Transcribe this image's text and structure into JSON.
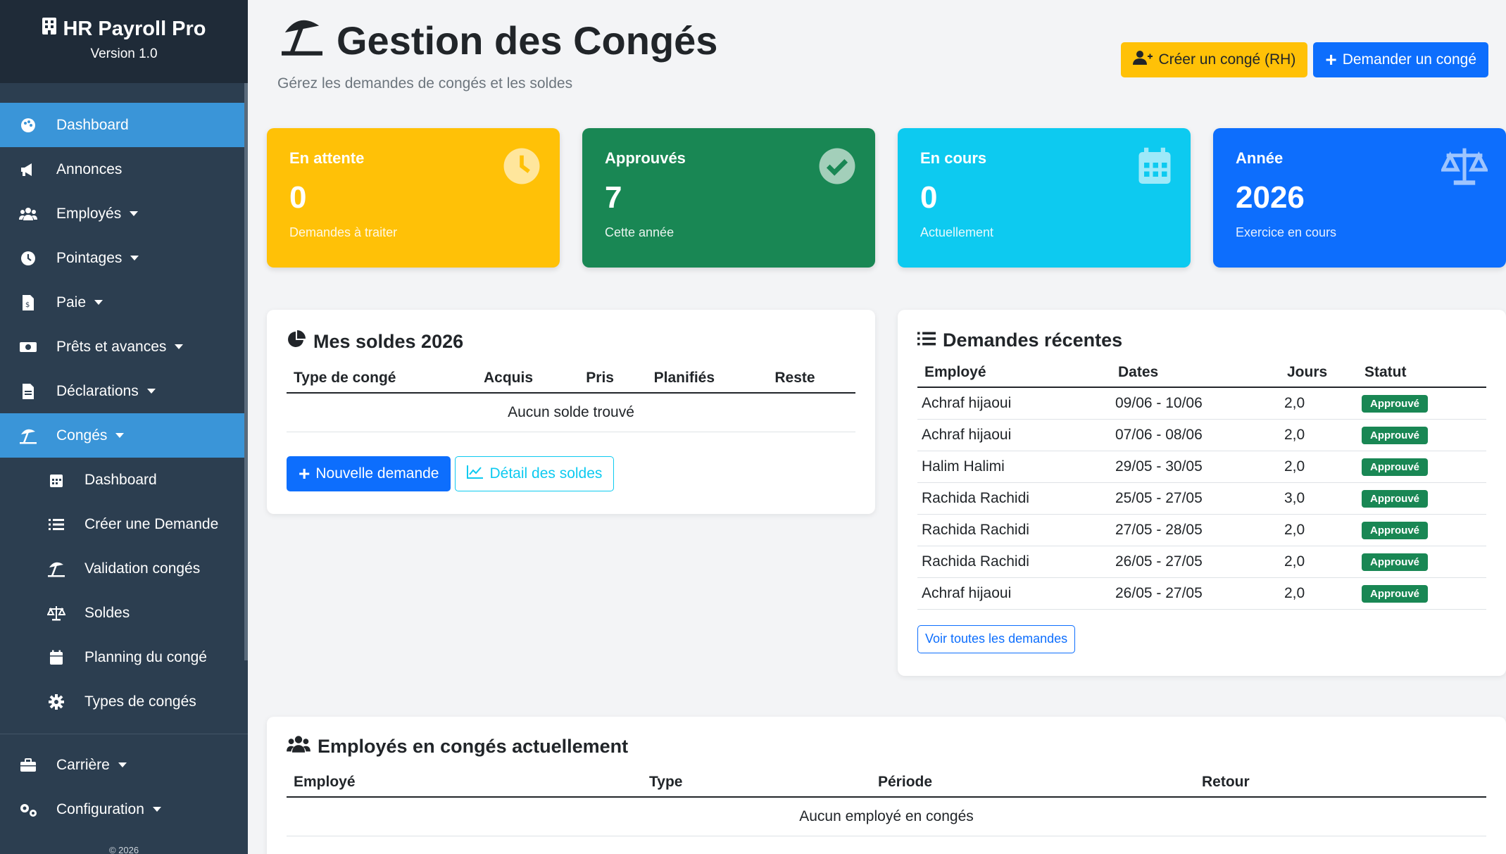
{
  "app": {
    "title": "HR Payroll Pro",
    "version": "Version 1.0",
    "copyright": "© 2026"
  },
  "sidebar": {
    "items": [
      {
        "label": "Dashboard",
        "icon": "palette-icon"
      },
      {
        "label": "Annonces",
        "icon": "megaphone-icon"
      },
      {
        "label": "Employés",
        "icon": "users-icon"
      },
      {
        "label": "Pointages",
        "icon": "clock-icon"
      },
      {
        "label": "Paie",
        "icon": "invoice-icon"
      },
      {
        "label": "Prêts et avances",
        "icon": "money-icon"
      },
      {
        "label": "Déclarations",
        "icon": "document-icon"
      },
      {
        "label": "Congés",
        "icon": "umbrella-beach-icon"
      }
    ],
    "sub_items": [
      {
        "label": "Dashboard",
        "icon": "calendar-icon"
      },
      {
        "label": "Créer une Demande",
        "icon": "list-icon"
      },
      {
        "label": "Validation congés",
        "icon": "umbrella-beach-icon"
      },
      {
        "label": "Soldes",
        "icon": "scale-icon"
      },
      {
        "label": "Planning du congé",
        "icon": "calendar-icon"
      },
      {
        "label": "Types de congés",
        "icon": "gear-icon"
      }
    ],
    "bottom_items": [
      {
        "label": "Carrière",
        "icon": "briefcase-icon"
      },
      {
        "label": "Configuration",
        "icon": "gears-icon"
      }
    ]
  },
  "header": {
    "title": "Gestion des Congés",
    "subtitle": "Gérez les demandes de congés et les soldes",
    "btn_create_rh": "Créer un congé (RH)",
    "btn_request": "Demander un congé"
  },
  "stats": [
    {
      "label": "En attente",
      "value": "0",
      "desc": "Demandes à traiter",
      "color": "#ffc107",
      "icon": "clock-icon"
    },
    {
      "label": "Approuvés",
      "value": "7",
      "desc": "Cette année",
      "color": "#198754",
      "icon": "check-circle-icon"
    },
    {
      "label": "En cours",
      "value": "0",
      "desc": "Actuellement",
      "color": "#0dcaf0",
      "icon": "calendar-icon"
    },
    {
      "label": "Année",
      "value": "2026",
      "desc": "Exercice en cours",
      "color": "#0d6efd",
      "icon": "scale-icon"
    }
  ],
  "soldes": {
    "title": "Mes soldes 2026",
    "headers": [
      "Type de congé",
      "Acquis",
      "Pris",
      "Planifiés",
      "Reste"
    ],
    "empty": "Aucun solde trouvé",
    "btn_new": "Nouvelle demande",
    "btn_detail": "Détail des soldes"
  },
  "recent": {
    "title": "Demandes récentes",
    "headers": [
      "Employé",
      "Dates",
      "Jours",
      "Statut"
    ],
    "rows": [
      {
        "employee": "Achraf hijaoui",
        "dates": "09/06 - 10/06",
        "days": "2,0",
        "status": "Approuvé"
      },
      {
        "employee": "Achraf hijaoui",
        "dates": "07/06 - 08/06",
        "days": "2,0",
        "status": "Approuvé"
      },
      {
        "employee": "Halim Halimi",
        "dates": "29/05 - 30/05",
        "days": "2,0",
        "status": "Approuvé"
      },
      {
        "employee": "Rachida Rachidi",
        "dates": "25/05 - 27/05",
        "days": "3,0",
        "status": "Approuvé"
      },
      {
        "employee": "Rachida Rachidi",
        "dates": "27/05 - 28/05",
        "days": "2,0",
        "status": "Approuvé"
      },
      {
        "employee": "Rachida Rachidi",
        "dates": "26/05 - 27/05",
        "days": "2,0",
        "status": "Approuvé"
      },
      {
        "employee": "Achraf hijaoui",
        "dates": "26/05 - 27/05",
        "days": "2,0",
        "status": "Approuvé"
      }
    ],
    "btn_all": "Voir toutes les demandes"
  },
  "on_leave": {
    "title": "Employés en congés actuellement",
    "headers": [
      "Employé",
      "Type",
      "Période",
      "Retour"
    ],
    "empty": "Aucun employé en congés"
  }
}
